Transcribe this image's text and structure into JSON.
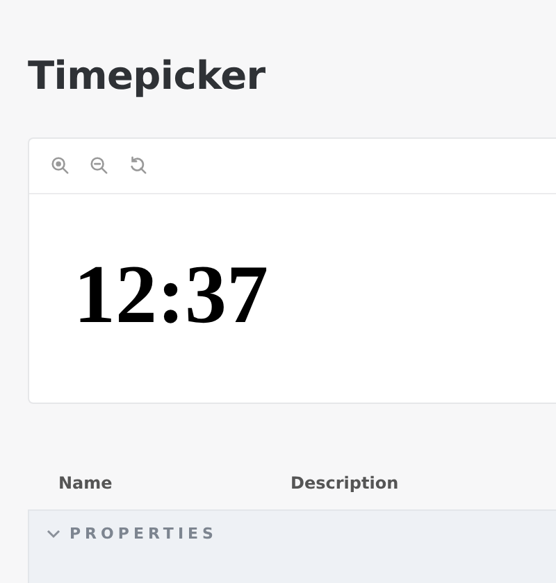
{
  "page": {
    "title": "Timepicker"
  },
  "preview": {
    "toolbar": [
      {
        "kind": "zoom-in"
      },
      {
        "kind": "zoom-out"
      },
      {
        "kind": "reset"
      }
    ],
    "time": "12:37"
  },
  "table": {
    "columns": [
      "Name",
      "Description"
    ],
    "groups": [
      {
        "label": "PROPERTIES",
        "expanded": true
      }
    ]
  }
}
